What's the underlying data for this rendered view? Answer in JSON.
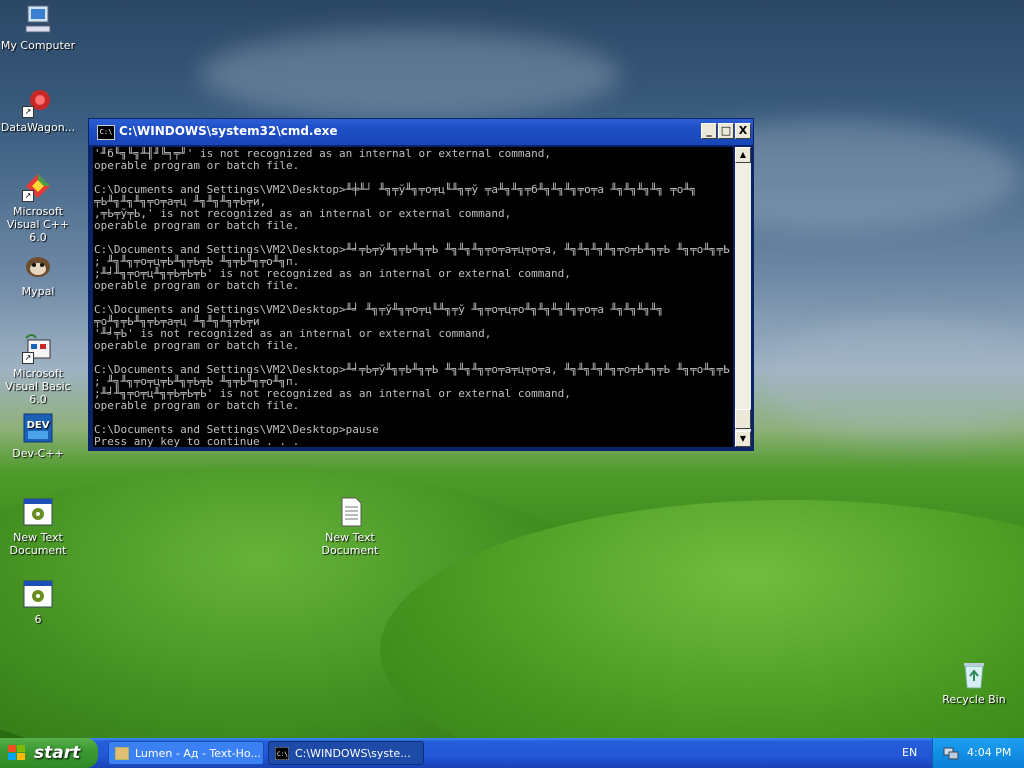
{
  "desktop": {
    "icons": [
      {
        "label": "My Computer"
      },
      {
        "label": "DataWagon..."
      },
      {
        "label": "Microsoft Visual C++ 6.0"
      },
      {
        "label": "Mypal"
      },
      {
        "label": "Microsoft Visual Basic 6.0"
      },
      {
        "label": "Dev-C++"
      },
      {
        "label": "New Text Document"
      },
      {
        "label": "6"
      },
      {
        "label": "New Text Document"
      },
      {
        "label": "Recycle Bin"
      }
    ]
  },
  "cmd_window": {
    "title": "C:\\WINDOWS\\system32\\cmd.exe",
    "icon_text": "C:\\",
    "min_label": "_",
    "max_label": "□",
    "close_label": "X",
    "console_text": "'╜б╙╗╙╗╨╢╜╚╕╤╜' is not recognized as an internal or external command,\noperable program or batch file.\n\nC:\\Documents and Settings\\VM2\\Desktop>╨╪╨┘ ╨╗╤ў╨╗╤о╤ц╙╨╗╤ў ╤а╨╗╨╗╤б╨╗╨╗╨╗╤о╤а ╨╗╨╗╨╗╨╗ ╤о╨╗\n╤Ь╨╗╨╗╨╗╤о╤а╤ц ╨╗╨╗╨╗╤Ь╤и,\n,╤Ь╤ў╤Ь,' is not recognized as an internal or external command,\noperable program or batch file.\n\nC:\\Documents and Settings\\VM2\\Desktop>╨╛╤Ь╤ў╨╗╤Ь╨╗╤Ь ╨╗╨╗╨╗╤о╤а╤ц╤о╤а, ╨╗╨╗╨╗╨╗╤о╤Ь╨╗╤Ь ╨╗╤о╨╗╤Ь\n; ╨╗╨╗╤о╤ц╤Ь╨╗╤Ь╤Ь ╨╗╤Ь╨╗╤о╨╗п.\n;╨╛╨╗╤о╤ц╨╗╤Ь╤Ь╤Ь' is not recognized as an internal or external command,\noperable program or batch file.\n\nC:\\Documents and Settings\\VM2\\Desktop>╨╛ ╨╗╤ў╨╗╤о╤ц╙╨╗╤ў ╨╗╤о╤ц╤о╨╗╨╗╨╗╨╗╤о╤а ╨╗╨╗╨╗╨╗\n╤о╨╗╤Ь╨╗╤Ь╤а╤ц ╨╗╨╗╨╗╤Ь╤и\n'╨╛╤Ь' is not recognized as an internal or external command,\noperable program or batch file.\n\nC:\\Documents and Settings\\VM2\\Desktop>╨╛╤Ь╤ў╨╗╤Ь╨╗╤Ь ╨╗╨╗╨╗╤о╤а╤ц╤о╤а, ╨╗╨╗╨╗╨╗╤о╤Ь╨╗╤Ь ╨╗╤о╨╗╤Ь\n; ╨╗╨╗╤о╤ц╤Ь╨╗╤Ь╤Ь ╨╗╤Ь╨╗╤о╨╗п.\n;╨╛╨╗╤о╤ц╨╗╤Ь╤Ь╤Ь' is not recognized as an internal or external command,\noperable program or batch file.\n\nC:\\Documents and Settings\\VM2\\Desktop>pause\nPress any key to continue . . . _"
  },
  "taskbar": {
    "start_label": "start",
    "tasks": [
      {
        "label": "Lumen - Ад - Text-Ho..."
      },
      {
        "label": "C:\\WINDOWS\\syste..."
      }
    ],
    "language": "EN",
    "clock": "4:04 PM"
  }
}
